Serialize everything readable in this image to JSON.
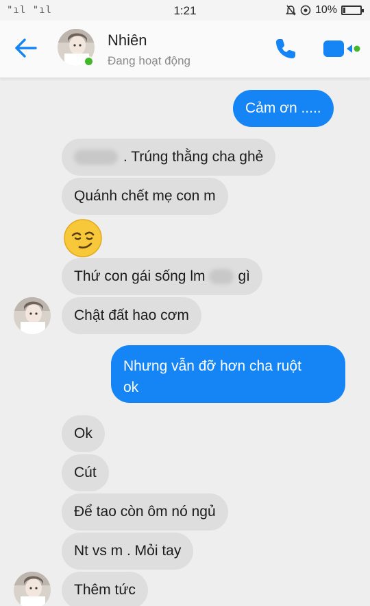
{
  "status_bar": {
    "signal": "\"ıl \"ıl",
    "time": "1:21",
    "battery": "10%"
  },
  "header": {
    "contact_name": "Nhiên",
    "contact_status": "Đang hoạt động"
  },
  "messages": [
    {
      "sender": "me",
      "text": "Cảm ơn ....."
    },
    {
      "sender": "them",
      "text": ". Trúng thằng cha ghẻ"
    },
    {
      "sender": "them",
      "text": "Quánh chết mẹ con m"
    },
    {
      "sender": "them",
      "emoji": "smirk-emoji"
    },
    {
      "sender": "them",
      "text_before": "Thứ con gái sống lm",
      "text_after": "gì"
    },
    {
      "sender": "them",
      "text": "Chật đất hao cơm"
    },
    {
      "sender": "me",
      "line1": "Nhưng vẫn đỡ hơn cha ruột",
      "line2": "ok"
    },
    {
      "sender": "them",
      "text": "Ok"
    },
    {
      "sender": "them",
      "text": "Cút"
    },
    {
      "sender": "them",
      "text": "Để tao còn ôm nó ngủ"
    },
    {
      "sender": "them",
      "text": "Nt vs m . Mỏi tay"
    },
    {
      "sender": "them",
      "text": "Thêm tức"
    }
  ],
  "colors": {
    "accent": "#1585f5",
    "incoming_bubble": "#dedede",
    "online": "#42b72a"
  }
}
